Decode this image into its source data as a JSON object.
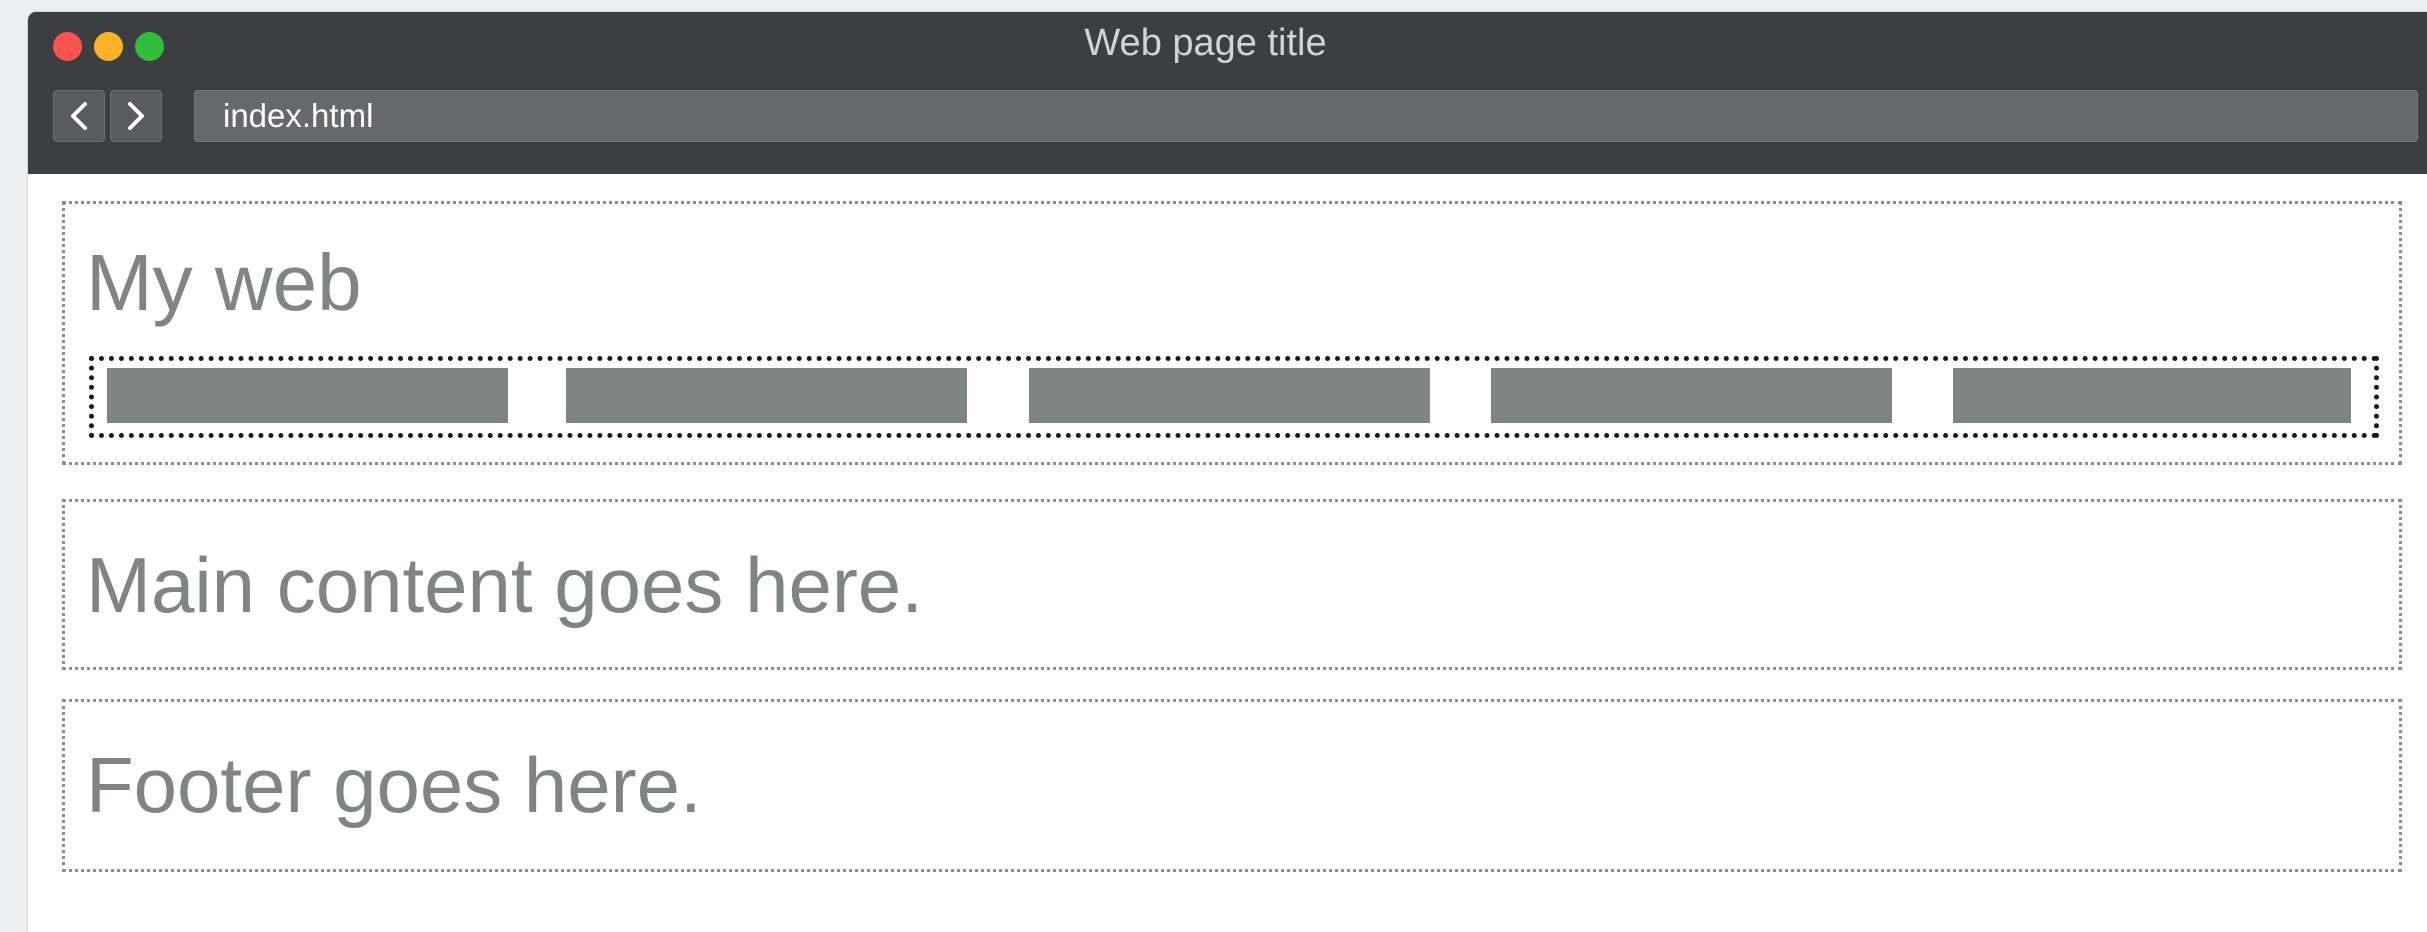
{
  "window": {
    "title": "Web page title",
    "controls": [
      "close",
      "minimize",
      "zoom"
    ]
  },
  "toolbar": {
    "back_icon": "chevron-left-icon",
    "forward_icon": "chevron-right-icon",
    "url": "index.html"
  },
  "page": {
    "header": {
      "site_title": "My web",
      "nav_items": [
        "",
        "",
        "",
        "",
        ""
      ]
    },
    "main": {
      "text": "Main content goes here."
    },
    "footer": {
      "text": "Footer goes here."
    }
  },
  "colors": {
    "chrome": "#3d3e42",
    "close": "#fb5350",
    "minimize": "#fcb229",
    "zoom": "#31bf3b",
    "placeholder_text": "#808584",
    "nav_item": "#808583"
  }
}
